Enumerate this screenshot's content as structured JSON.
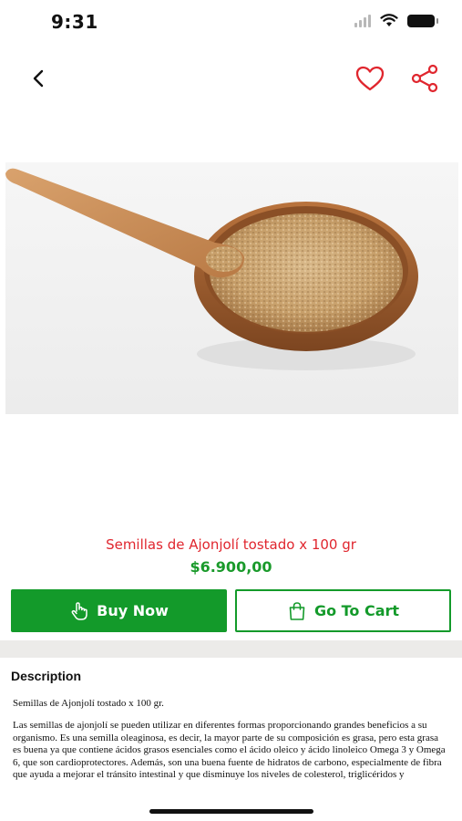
{
  "status_bar": {
    "time": "9:31",
    "icons": [
      "signal-icon",
      "wifi-icon",
      "battery-icon"
    ]
  },
  "nav": {
    "back_icon": "chevron-left-icon",
    "favorite_icon": "heart-icon",
    "share_icon": "share-icon"
  },
  "colors": {
    "accent_red": "#e0262e",
    "primary_green": "#139a2a",
    "divider": "#ecebe9"
  },
  "product": {
    "image": "toasted-sesame-seeds-bowl-with-wooden-spoon",
    "name": "Semillas de Ajonjolí tostado x 100 gr",
    "price": "$6.900,00"
  },
  "actions": {
    "buy_now": {
      "label": "Buy Now",
      "icon": "hand-pointer-icon"
    },
    "go_to_cart": {
      "label": "Go To Cart",
      "icon": "shopping-bag-icon"
    }
  },
  "description": {
    "title": "Description",
    "subtitle": "Semillas de Ajonjolí tostado x 100 gr.",
    "body": "Las semillas de ajonjolí se pueden utilizar en diferentes formas proporcionando grandes beneficios a su organismo. Es una semilla oleaginosa, es decir, la mayor parte de su composición es grasa, pero esta grasa es buena ya que contiene ácidos grasos esenciales como el ácido oleico y ácido linoleico Omega 3 y Omega 6, que son cardioprotectores. Además, son una buena fuente de hidratos de carbono, especialmente de fibra que ayuda a mejorar el tránsito intestinal y que disminuye los niveles de colesterol, triglicéridos y"
  }
}
